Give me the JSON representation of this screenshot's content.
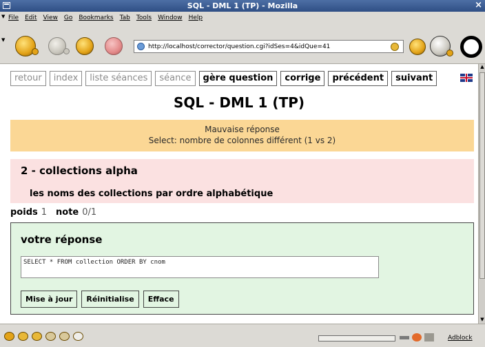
{
  "window": {
    "title": "SQL - DML 1 (TP) - Mozilla",
    "close_glyph": "×"
  },
  "menubar": {
    "items": [
      "File",
      "Edit",
      "View",
      "Go",
      "Bookmarks",
      "Tab",
      "Tools",
      "Window",
      "Help"
    ]
  },
  "toolbar": {
    "url": "http://localhost/corrector/question.cgi?idSes=4&idQue=41",
    "icons": [
      "back-icon",
      "forward-icon",
      "reload-icon",
      "stop-icon",
      "search-icon",
      "print-icon",
      "throbber-icon"
    ]
  },
  "nav": {
    "links": [
      {
        "label": "retour",
        "active": false
      },
      {
        "label": "index",
        "active": false
      },
      {
        "label": "liste séances",
        "active": false
      },
      {
        "label": "séance",
        "active": false
      },
      {
        "label": "gère question",
        "active": true
      },
      {
        "label": "corrige",
        "active": true
      },
      {
        "label": "précédent",
        "active": true
      },
      {
        "label": "suivant",
        "active": true
      }
    ]
  },
  "page": {
    "title": "SQL - DML 1 (TP)"
  },
  "feedback": {
    "line1": "Mauvaise réponse",
    "line2": "Select: nombre de colonnes différent (1 vs 2)"
  },
  "question": {
    "title": "2 - collections alpha",
    "description": "les noms des collections par ordre alphabétique"
  },
  "score": {
    "weight_label": "poids",
    "weight_value": "1",
    "grade_label": "note",
    "grade_value": "0/1"
  },
  "answer": {
    "title": "votre réponse",
    "sql": "SELECT * FROM collection ORDER BY cnom",
    "buttons": {
      "update": "Mise à jour",
      "reset": "Réinitialise",
      "clear": "Efface"
    }
  },
  "statusbar": {
    "adblock": "Adblock"
  },
  "colors": {
    "warning_bg": "#fbd795",
    "question_bg": "#fbe1e1",
    "answer_bg": "#e2f5e2",
    "titlebar": "#3d5f95"
  }
}
